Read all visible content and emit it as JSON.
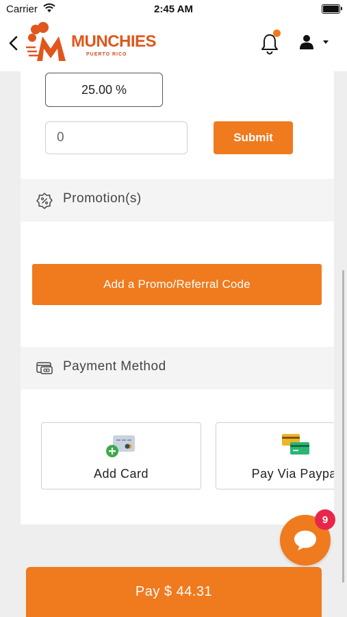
{
  "status_bar": {
    "carrier": "Carrier",
    "time": "2:45 AM"
  },
  "header": {
    "logo_text": "MUNCHIES",
    "logo_subtext": "PUERTO RICO",
    "brand_color": "#f07a1e",
    "notification_dot": true
  },
  "tip": {
    "percent_value": "25.00 %",
    "amount_value": "0",
    "submit_label": "Submit"
  },
  "promotions": {
    "section_title": "Promotion(s)",
    "add_code_label": "Add a Promo/Referral Code"
  },
  "payment": {
    "section_title": "Payment Method",
    "methods": [
      {
        "label": "Add Card",
        "icon": "add-card-icon"
      },
      {
        "label": "Pay Via Paypal",
        "icon": "paypal-cards-icon"
      }
    ]
  },
  "chat": {
    "badge_count": "9"
  },
  "pay_button": {
    "label": "Pay $ 44.31"
  }
}
